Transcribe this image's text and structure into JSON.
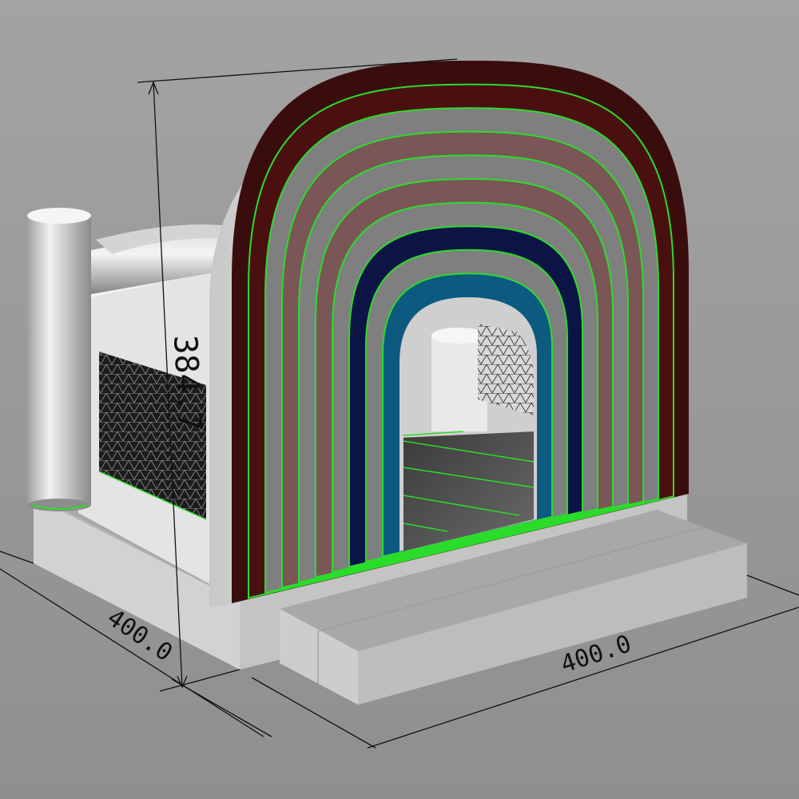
{
  "dimensions": {
    "height_label": "384.7",
    "depth_label": "400.0",
    "width_label": "400.0"
  },
  "colors": {
    "background": "#9a9a9a",
    "outline_green": "#2bdc2b",
    "arch_outer": "#3a0d0d",
    "arch_maroon": "#4a1010",
    "arch_gray": "#7f7f7f",
    "arch_mauve": "#7a5656",
    "arch_navy": "#0c1445",
    "arch_teal": "#0d5a80",
    "structure_white": "#e6e6e6",
    "mesh_dark": "#1e1e1e"
  },
  "parts": {
    "front_arch": "rainbow-arch",
    "side_panel": "side-wall",
    "mesh": "net-window",
    "base": "base-platform",
    "step": "front-step",
    "pillar": "corner-pillar",
    "beam": "top-beam"
  }
}
